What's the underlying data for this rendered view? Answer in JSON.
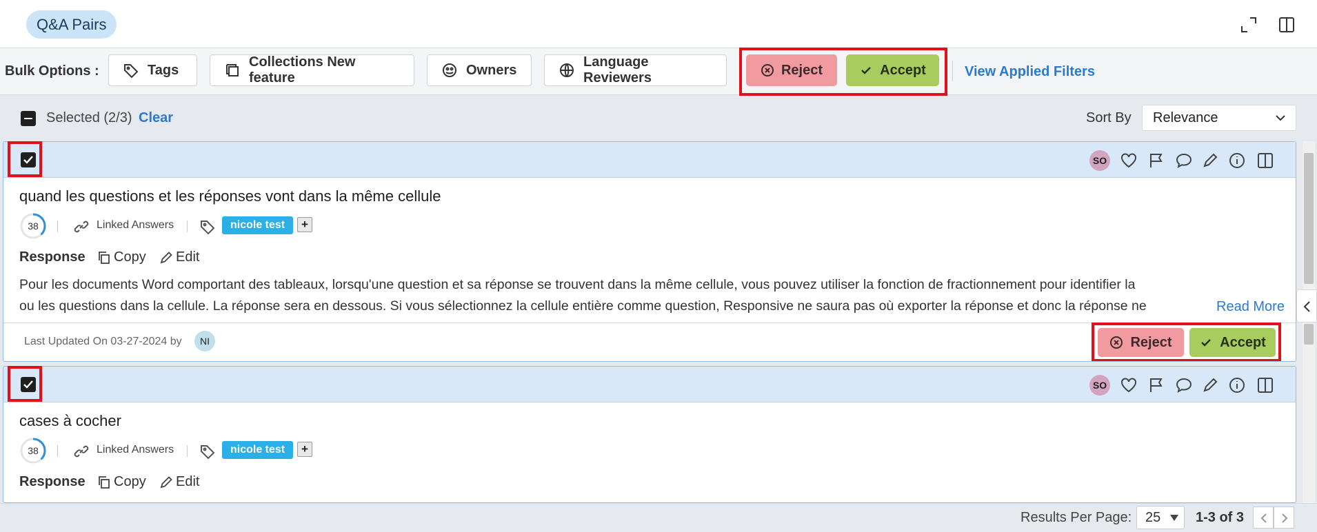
{
  "header": {
    "title": "Q&A Pairs",
    "expand_icon": "expand-icon",
    "panel_icon": "split-panel-icon"
  },
  "bulk": {
    "label": "Bulk Options :",
    "tags": "Tags",
    "collections": "Collections New feature",
    "owners": "Owners",
    "language_reviewers": "Language Reviewers",
    "reject": "Reject",
    "accept": "Accept",
    "view_filters": "View Applied Filters"
  },
  "selection": {
    "text": "Selected (2/3)",
    "clear": "Clear"
  },
  "sort": {
    "label": "Sort By",
    "value": "Relevance"
  },
  "cards": [
    {
      "owner_initials": "SO",
      "title": "quand les questions et les réponses vont dans la même cellule",
      "score": "38",
      "score_fraction": 0.38,
      "linked": "Linked Answers",
      "tag": "nicole test",
      "plus": "+",
      "response_label": "Response",
      "copy": "Copy",
      "edit": "Edit",
      "line1": "Pour les documents Word comportant des tableaux, lorsqu'une question et sa réponse se trouvent dans la même cellule, vous pouvez utiliser la fonction de fractionnement pour identifier la",
      "line2": "ou les questions dans la cellule. La réponse sera en dessous. Si vous sélectionnez la cellule entière comme question, Responsive ne saura pas où exporter la réponse et donc la réponse ne",
      "read_more": "Read More",
      "updated": "Last Updated On 03-27-2024 by",
      "updater_initials": "NI",
      "reject": "Reject",
      "accept": "Accept"
    },
    {
      "owner_initials": "SO",
      "title": "cases à cocher",
      "score": "38",
      "score_fraction": 0.38,
      "linked": "Linked Answers",
      "tag": "nicole test",
      "plus": "+",
      "response_label": "Response",
      "copy": "Copy",
      "edit": "Edit"
    }
  ],
  "footer": {
    "rpp_label": "Results Per Page:",
    "rpp_value": "25",
    "range": "1-3 of 3"
  },
  "colors": {
    "accent": "#2a7ad0",
    "reject": "#f19aa0",
    "accept": "#a9cc5e",
    "tag": "#2ab0e6",
    "highlight": "#e0111b",
    "card_head": "#d8e8f8"
  }
}
